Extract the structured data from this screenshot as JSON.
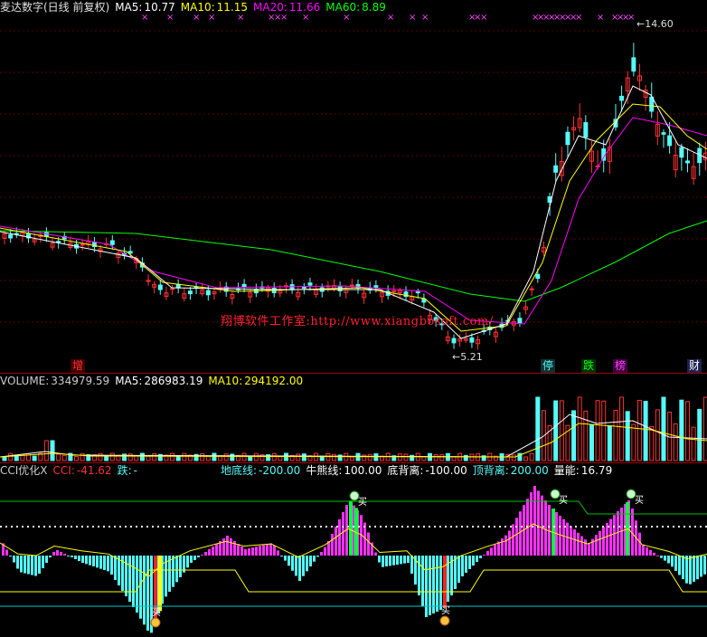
{
  "main": {
    "title": "麦达数字(日线 前复权)",
    "ma5_label": "MA5:",
    "ma5": "10.77",
    "ma10_label": "MA10:",
    "ma10": "11.15",
    "ma20_label": "MA20:",
    "ma20": "11.66",
    "ma60_label": "MA60:",
    "ma60": "8.89",
    "high_price": "14.60",
    "low_price": "5.21",
    "watermark": "翔博软件工作室:http://www.xiangbosoft.com/",
    "tags": [
      "增",
      "停",
      "跌",
      "榜",
      "财"
    ],
    "marker": "×"
  },
  "volume": {
    "label": "VOLUME:",
    "value": "334979.59",
    "ma5_label": "MA5:",
    "ma5": "286983.19",
    "ma10_label": "MA10:",
    "ma10": "294192.00"
  },
  "cci": {
    "title": "CCI优化X",
    "cci_label": "CCI:",
    "cci": "-41.62",
    "fall_label": "跌:",
    "fall": "-",
    "floor_label": "地底线:",
    "floor": "-200.00",
    "bull_label": "牛熊线:",
    "bull": "100.00",
    "bottom_div_label": "底背离:",
    "bottom_div": "-100.00",
    "top_div_label": "顶背离:",
    "top_div": "200.00",
    "energy_label": "量能:",
    "energy": "16.79",
    "buy_label": "买"
  },
  "colors": {
    "up": "#ff3232",
    "down": "#54fcfc",
    "ma5": "#ffffff",
    "ma10": "#ffff00",
    "ma20": "#ff00ff",
    "ma60": "#00ff00",
    "separator": "#a00000"
  }
}
